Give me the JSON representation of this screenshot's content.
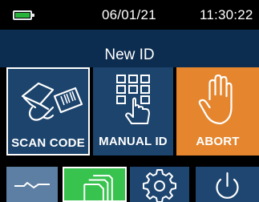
{
  "status": {
    "date": "06/01/21",
    "time": "11:30:22",
    "battery_level": 1.0
  },
  "screen": {
    "title": "New ID"
  },
  "actions": [
    {
      "id": "scan",
      "label": "SCAN CODE",
      "icon": "barcode-scanner-icon",
      "color": "#1c446c",
      "selected": true
    },
    {
      "id": "manual",
      "label": "MANUAL ID",
      "icon": "keypad-hand-icon",
      "color": "#1c446c",
      "selected": false
    },
    {
      "id": "abort",
      "label": "ABORT",
      "icon": "stop-hand-icon",
      "color": "#e5862f",
      "selected": false
    }
  ],
  "nav": [
    {
      "id": "graph",
      "icon": "line-graph-icon",
      "selected": false
    },
    {
      "id": "files",
      "icon": "files-icon",
      "selected": true
    },
    {
      "id": "settings",
      "icon": "gear-icon",
      "selected": false
    },
    {
      "id": "power",
      "icon": "power-icon",
      "selected": false
    }
  ],
  "colors": {
    "titlebar": "#0c2d4f",
    "tile_blue": "#1c446c",
    "abort_orange": "#e5862f",
    "nav_selected_green": "#38c24e",
    "nav_blue": "#1e4670",
    "battery_green": "#27b33a"
  }
}
